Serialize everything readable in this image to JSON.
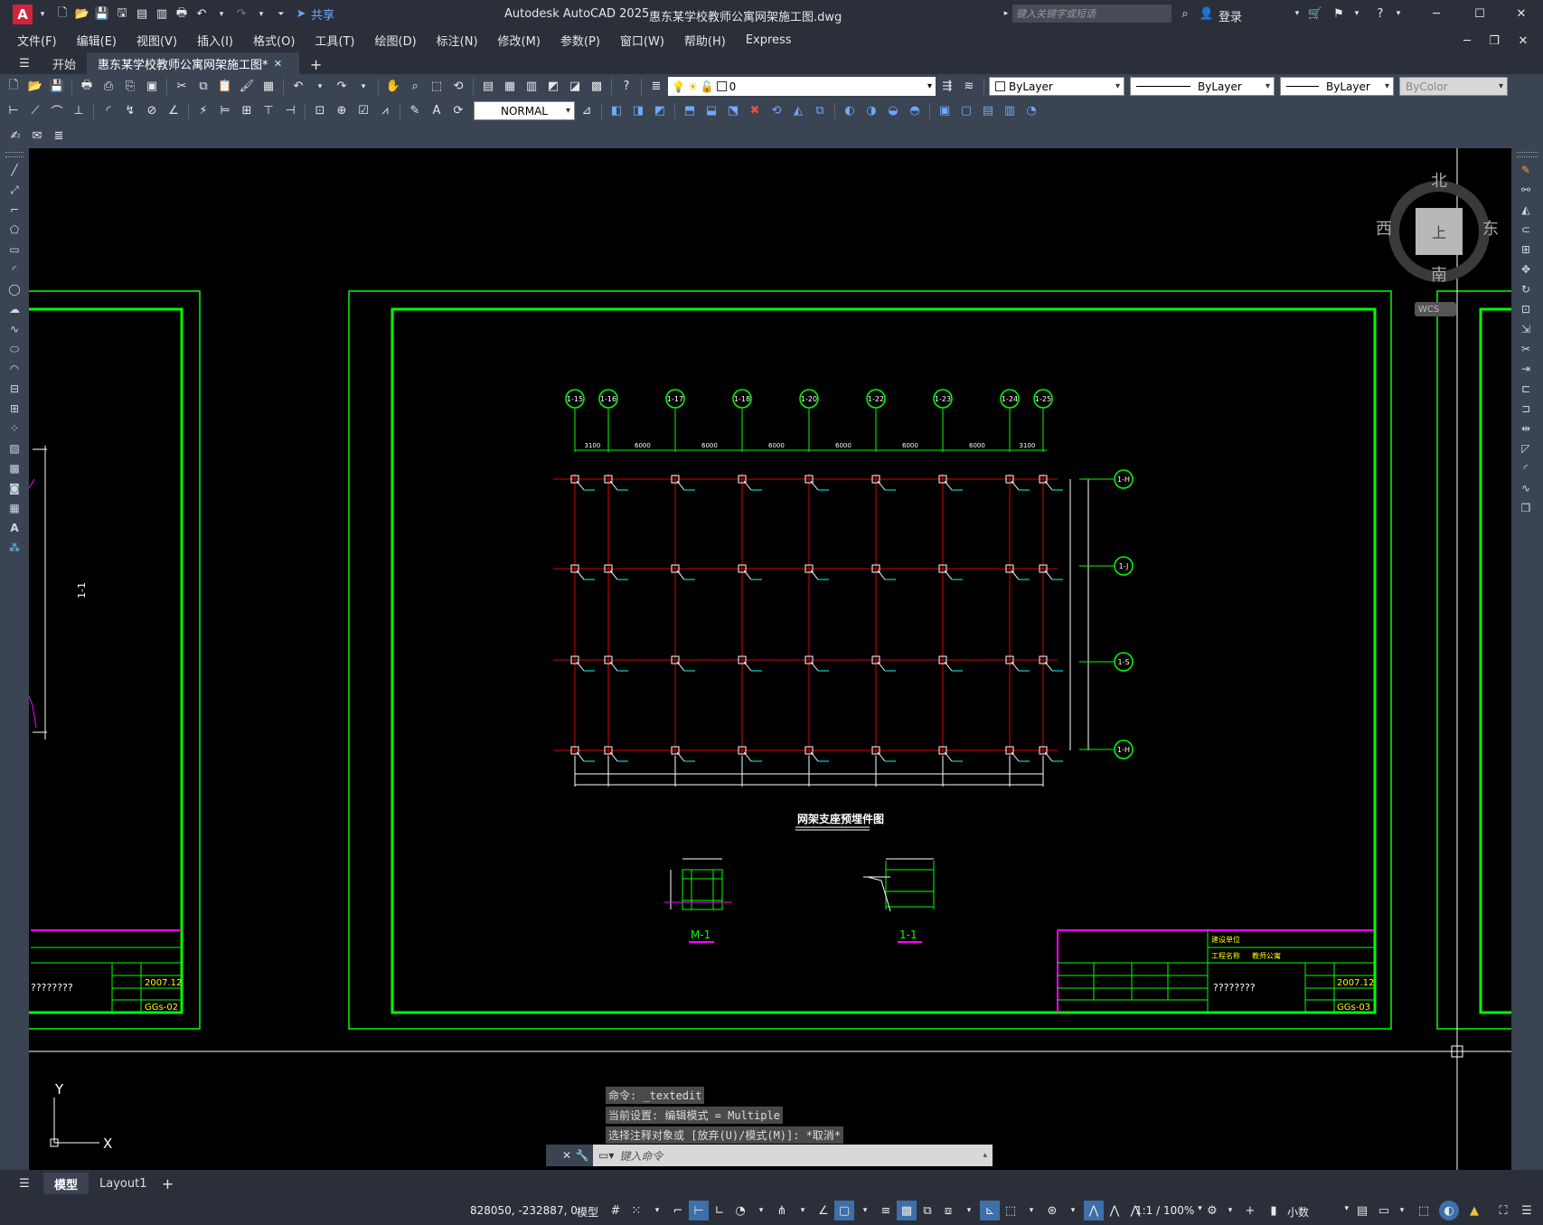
{
  "window": {
    "app_title": "Autodesk AutoCAD 2025",
    "file_title": "惠东某学校教师公寓网架施工图.dwg",
    "share_label": "共享",
    "search_placeholder": "键入关键字或短语",
    "login_label": "登录"
  },
  "menu": [
    "文件(F)",
    "编辑(E)",
    "视图(V)",
    "插入(I)",
    "格式(O)",
    "工具(T)",
    "绘图(D)",
    "标注(N)",
    "修改(M)",
    "参数(P)",
    "窗口(W)",
    "帮助(H)",
    "Express"
  ],
  "tabs": {
    "start": "开始",
    "drawing": "惠东某学校教师公寓网架施工图*"
  },
  "properties": {
    "layer": "0",
    "color": "ByLayer",
    "linetype": "ByLayer",
    "lineweight": "ByLayer",
    "plotstyle": "ByColor",
    "dimstyle": "NORMAL"
  },
  "viewcube": {
    "north": "北",
    "south": "南",
    "east": "东",
    "west": "西",
    "top": "上",
    "wcs": "WCS"
  },
  "drawing": {
    "grid_top": [
      "1-15",
      "1-16",
      "1-17",
      "1-18",
      "1-20",
      "1-22",
      "1-23",
      "1-24",
      "1-25"
    ],
    "grid_right": [
      "1-H",
      "1-J",
      "1-S",
      "1-H"
    ],
    "top_dims": [
      "3100",
      "6000",
      "6000",
      "6000",
      "6000",
      "6000",
      "6000",
      "3100"
    ],
    "plan_title": "网架支座预埋件图",
    "detail_m1": "M-1",
    "detail_11": "1-1",
    "left_section": "1-1",
    "title_block": {
      "unknown_text": "????????",
      "date": "2007.12",
      "sheet_left": "GGs-02",
      "sheet_right": "GGs-03",
      "unit_label": "建设单位",
      "project_label": "工程名称",
      "project_name": "教师公寓"
    }
  },
  "command_history": [
    "命令: _textedit",
    "当前设置: 编辑模式 = Multiple",
    "选择注释对象或 [放弃(U)/模式(M)]: *取消*"
  ],
  "command_placeholder": "键入命令",
  "layout_tabs": {
    "model": "模型",
    "layout1": "Layout1"
  },
  "status": {
    "coords": "828050, -232887, 0",
    "mode": "模型",
    "scale": "1:1 / 100%",
    "units": "小数"
  },
  "ucs": {
    "x": "X",
    "y": "Y"
  }
}
